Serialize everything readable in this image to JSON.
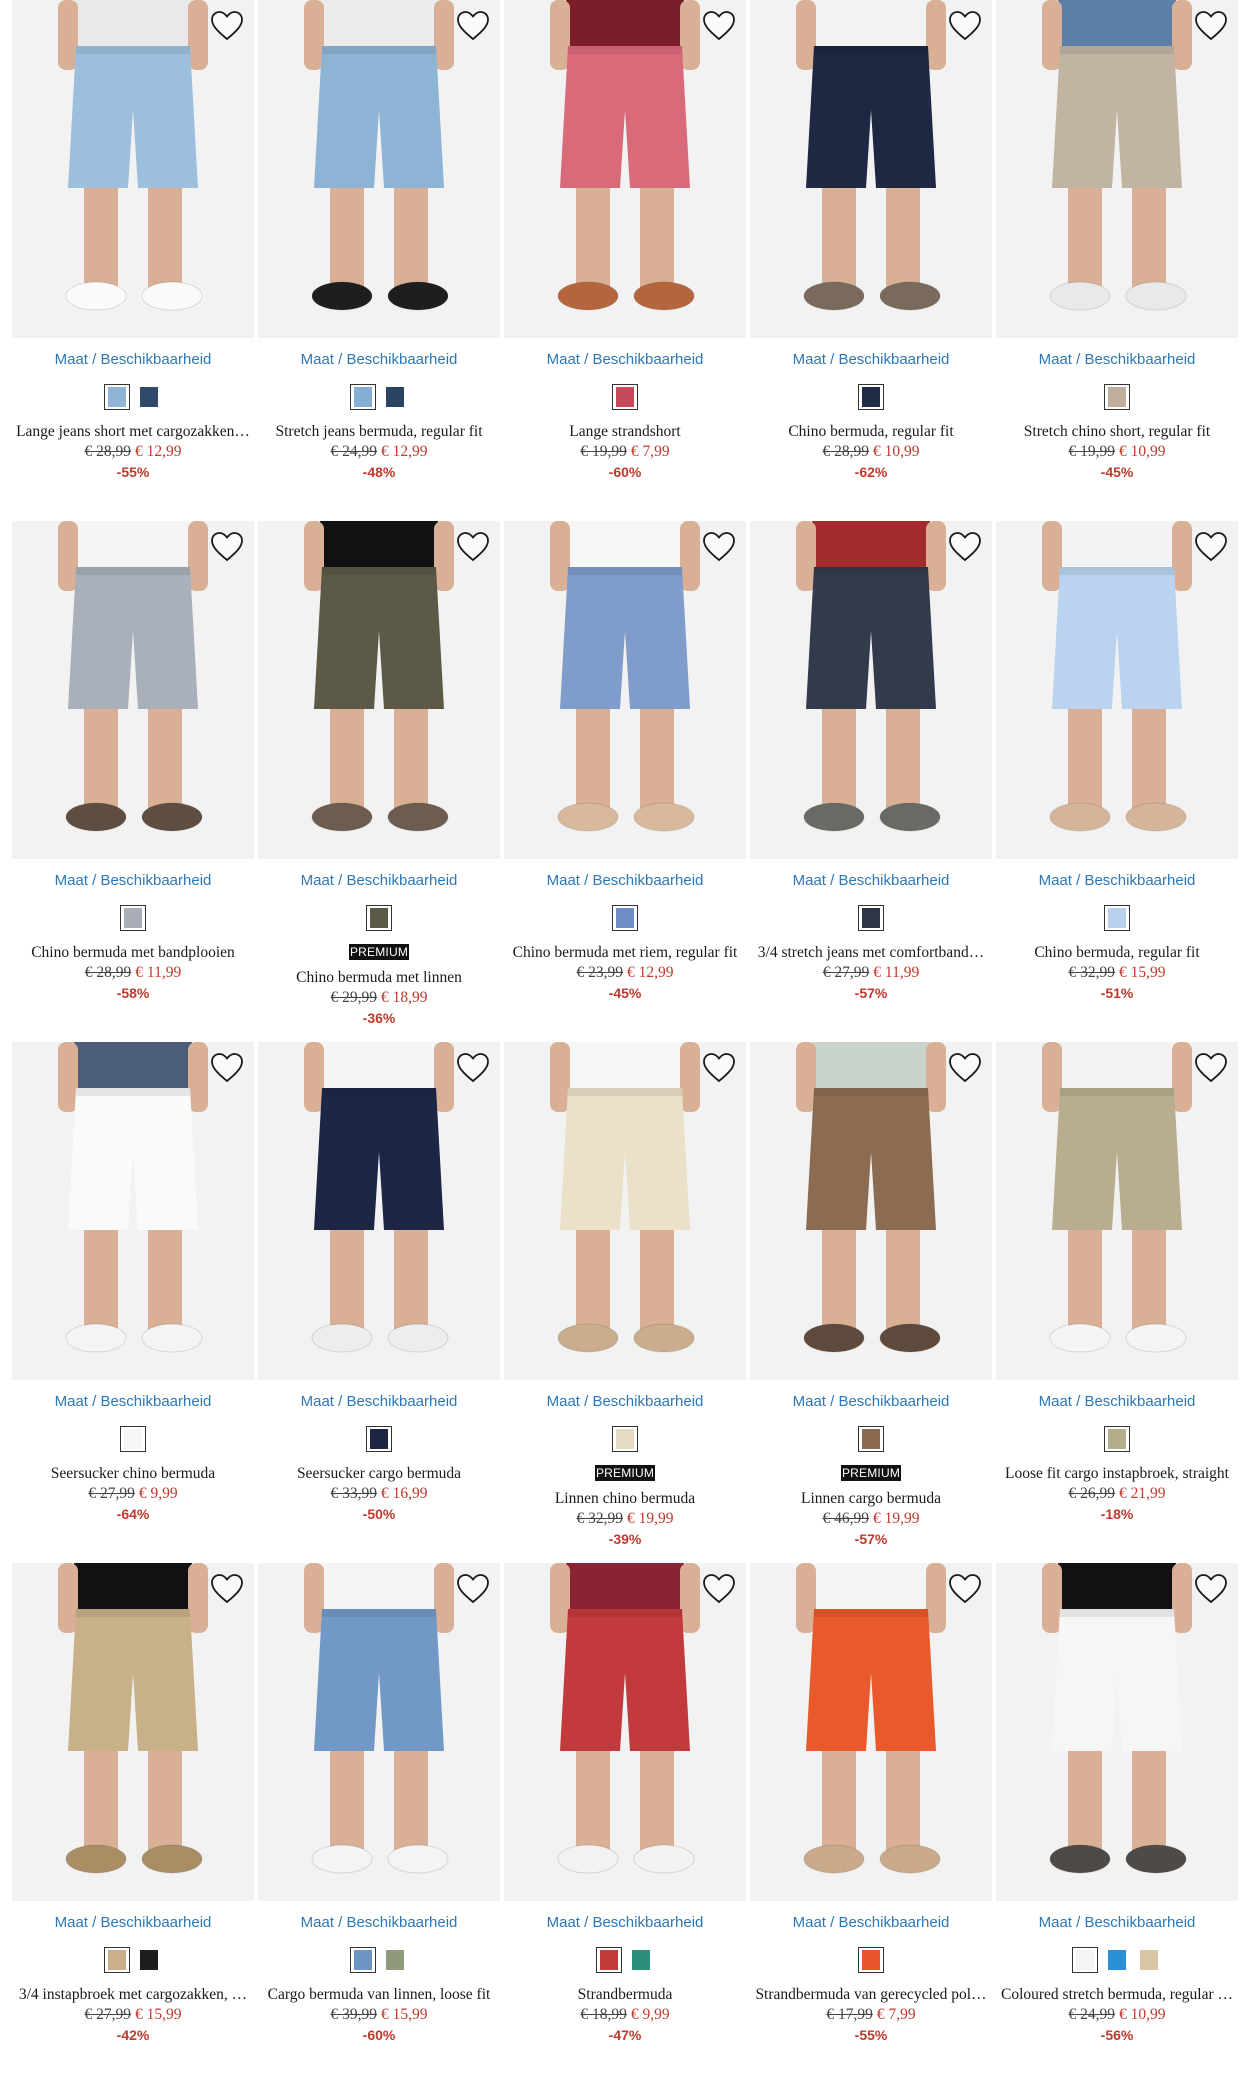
{
  "availability_label": "Maat / Beschikbaarheid",
  "products": [
    {
      "title": "Lange jeans short met cargozakken…",
      "old_price": "€ 28,99",
      "new_price": "€ 12,99",
      "discount": "-55%",
      "badge": "",
      "colors": [
        "#8fb4d6",
        "#2f4a6b"
      ],
      "top": "#e9e9e9",
      "bottom": "#9dbfdd",
      "shoes": "#fafafa"
    },
    {
      "title": "Stretch jeans bermuda, regular fit",
      "old_price": "€ 24,99",
      "new_price": "€ 12,99",
      "discount": "-48%",
      "badge": "",
      "colors": [
        "#84aed2",
        "#2c4463"
      ],
      "top": "#ececec",
      "bottom": "#8db3d5",
      "shoes": "#1e1e1e"
    },
    {
      "title": "Lange strandshort",
      "old_price": "€ 19,99",
      "new_price": "€ 7,99",
      "discount": "-60%",
      "badge": "",
      "colors": [
        "#c64a5a"
      ],
      "top": "#7a1f2a",
      "bottom": "#d96a7a",
      "shoes": "#b5653c"
    },
    {
      "title": "Chino bermuda, regular fit",
      "old_price": "€ 28,99",
      "new_price": "€ 10,99",
      "discount": "-62%",
      "badge": "",
      "colors": [
        "#1f2a44"
      ],
      "top": "#f2f2f2",
      "bottom": "#1e2842",
      "shoes": "#7a6a5c"
    },
    {
      "title": "Stretch chino short, regular fit",
      "old_price": "€ 19,99",
      "new_price": "€ 10,99",
      "discount": "-45%",
      "badge": "",
      "colors": [
        "#bfae9b"
      ],
      "top": "#5b7fa8",
      "bottom": "#c2b4a3",
      "shoes": "#e9e9e9"
    },
    {
      "title": "Chino bermuda met bandplooien",
      "old_price": "€ 28,99",
      "new_price": "€ 11,99",
      "discount": "-58%",
      "badge": "",
      "colors": [
        "#a9aeb6"
      ],
      "top": "#f5f5f5",
      "bottom": "#aab0b9",
      "shoes": "#5e4e42"
    },
    {
      "title": "Chino bermuda met linnen",
      "old_price": "€ 29,99",
      "new_price": "€ 18,99",
      "discount": "-36%",
      "badge": "PREMIUM",
      "colors": [
        "#5b5a46"
      ],
      "top": "#111111",
      "bottom": "#5c5a47",
      "shoes": "#6d5d50"
    },
    {
      "title": "Chino bermuda met riem, regular fit",
      "old_price": "€ 23,99",
      "new_price": "€ 12,99",
      "discount": "-45%",
      "badge": "",
      "colors": [
        "#6f8fc4"
      ],
      "top": "#f7f7f7",
      "bottom": "#7f9ccb",
      "shoes": "#d9b99b"
    },
    {
      "title": "3/4 stretch jeans met comfortband…",
      "old_price": "€ 27,99",
      "new_price": "€ 11,99",
      "discount": "-57%",
      "badge": "",
      "colors": [
        "#2e3545"
      ],
      "top": "#a22c2c",
      "bottom": "#323a4b",
      "shoes": "#6a6a64"
    },
    {
      "title": "Chino bermuda, regular fit",
      "old_price": "€ 32,99",
      "new_price": "€ 15,99",
      "discount": "-51%",
      "badge": "",
      "colors": [
        "#b7d0ec"
      ],
      "top": "#f3f3f3",
      "bottom": "#bad3ee",
      "shoes": "#d5b59a"
    },
    {
      "title": "Seersucker chino bermuda",
      "old_price": "€ 27,99",
      "new_price": "€ 9,99",
      "discount": "-64%",
      "badge": "",
      "colors": [
        "#f6f6f6"
      ],
      "top": "#4c5d7a",
      "bottom": "#fafafa",
      "shoes": "#f4f4f4"
    },
    {
      "title": "Seersucker cargo bermuda",
      "old_price": "€ 33,99",
      "new_price": "€ 16,99",
      "discount": "-50%",
      "badge": "",
      "colors": [
        "#1c2541"
      ],
      "top": "#f5f5f5",
      "bottom": "#1d2645",
      "shoes": "#ededed"
    },
    {
      "title": "Linnen chino bermuda",
      "old_price": "€ 32,99",
      "new_price": "€ 19,99",
      "discount": "-39%",
      "badge": "PREMIUM",
      "colors": [
        "#e7dcc3"
      ],
      "top": "#f7f7f7",
      "bottom": "#ebe1c8",
      "shoes": "#c9ad8d"
    },
    {
      "title": "Linnen cargo bermuda",
      "old_price": "€ 46,99",
      "new_price": "€ 19,99",
      "discount": "-57%",
      "badge": "PREMIUM",
      "colors": [
        "#8a6a50"
      ],
      "top": "#c9d3cc",
      "bottom": "#8b6c52",
      "shoes": "#5d4a3d"
    },
    {
      "title": "Loose fit cargo instapbroek, straight",
      "old_price": "€ 26,99",
      "new_price": "€ 21,99",
      "discount": "-18%",
      "badge": "",
      "colors": [
        "#b5ac8c"
      ],
      "top": "#f2f2f2",
      "bottom": "#b8ae8f",
      "shoes": "#f5f5f5"
    },
    {
      "title": "3/4 instapbroek met cargozakken, …",
      "old_price": "€ 27,99",
      "new_price": "€ 15,99",
      "discount": "-42%",
      "badge": "",
      "colors": [
        "#c9b08a",
        "#1e1e1e"
      ],
      "top": "#111111",
      "bottom": "#c8b088",
      "shoes": "#a98d64"
    },
    {
      "title": "Cargo bermuda van linnen, loose fit",
      "old_price": "€ 39,99",
      "new_price": "€ 15,99",
      "discount": "-60%",
      "badge": "",
      "colors": [
        "#6d95c3",
        "#8f9a7a"
      ],
      "top": "#f4f4f4",
      "bottom": "#7299c6",
      "shoes": "#f4f4f4"
    },
    {
      "title": "Strandbermuda",
      "old_price": "€ 18,99",
      "new_price": "€ 9,99",
      "discount": "-47%",
      "badge": "",
      "colors": [
        "#c23b3b",
        "#2b8f7a"
      ],
      "top": "#8a2434",
      "bottom": "#c33a3d",
      "shoes": "#f2f2f2"
    },
    {
      "title": "Strandbermuda van gerecycled pol…",
      "old_price": "€ 17,99",
      "new_price": "€ 7,99",
      "discount": "-55%",
      "badge": "",
      "colors": [
        "#e8532a"
      ],
      "top": "#f5f5f5",
      "bottom": "#e85a2b",
      "shoes": "#caa98a"
    },
    {
      "title": "Coloured stretch bermuda, regular …",
      "old_price": "€ 24,99",
      "new_price": "€ 10,99",
      "discount": "-56%",
      "badge": "",
      "colors": [
        "#f4f4f4",
        "#2b8fd6",
        "#d8c6a4"
      ],
      "top": "#111111",
      "bottom": "#f6f6f6",
      "shoes": "#4d4a48"
    }
  ]
}
